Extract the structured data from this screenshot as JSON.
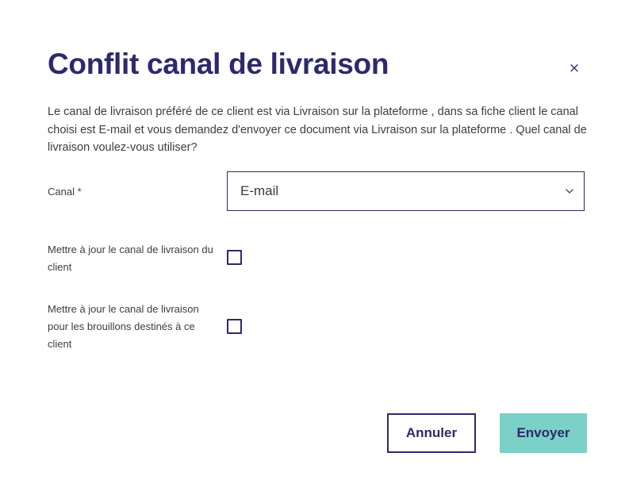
{
  "modal": {
    "title": "Conflit canal de livraison",
    "close_glyph": "×",
    "close_icon": "close-icon",
    "description": "Le canal de livraison préféré de ce client est via Livraison sur la plateforme , dans sa fiche client le canal choisi est E-mail et vous demandez d'envoyer ce document via Livraison sur la plateforme . Quel canal de livraison voulez-vous utiliser?"
  },
  "form": {
    "canal_label": "Canal *",
    "canal_value": "E-mail",
    "canal_icon": "chevron-down-icon",
    "update_client_label": "Mettre à jour le canal de livraison du client",
    "update_client_checked": false,
    "update_drafts_label": "Mettre à jour le canal de livraison pour les brouillons destinés à ce client",
    "update_drafts_checked": false
  },
  "actions": {
    "cancel_label": "Annuler",
    "send_label": "Envoyer"
  },
  "colors": {
    "primary": "#2c2a6b",
    "accent": "#7bd0c8",
    "text": "#3d3d3d",
    "background": "#ffffff"
  }
}
